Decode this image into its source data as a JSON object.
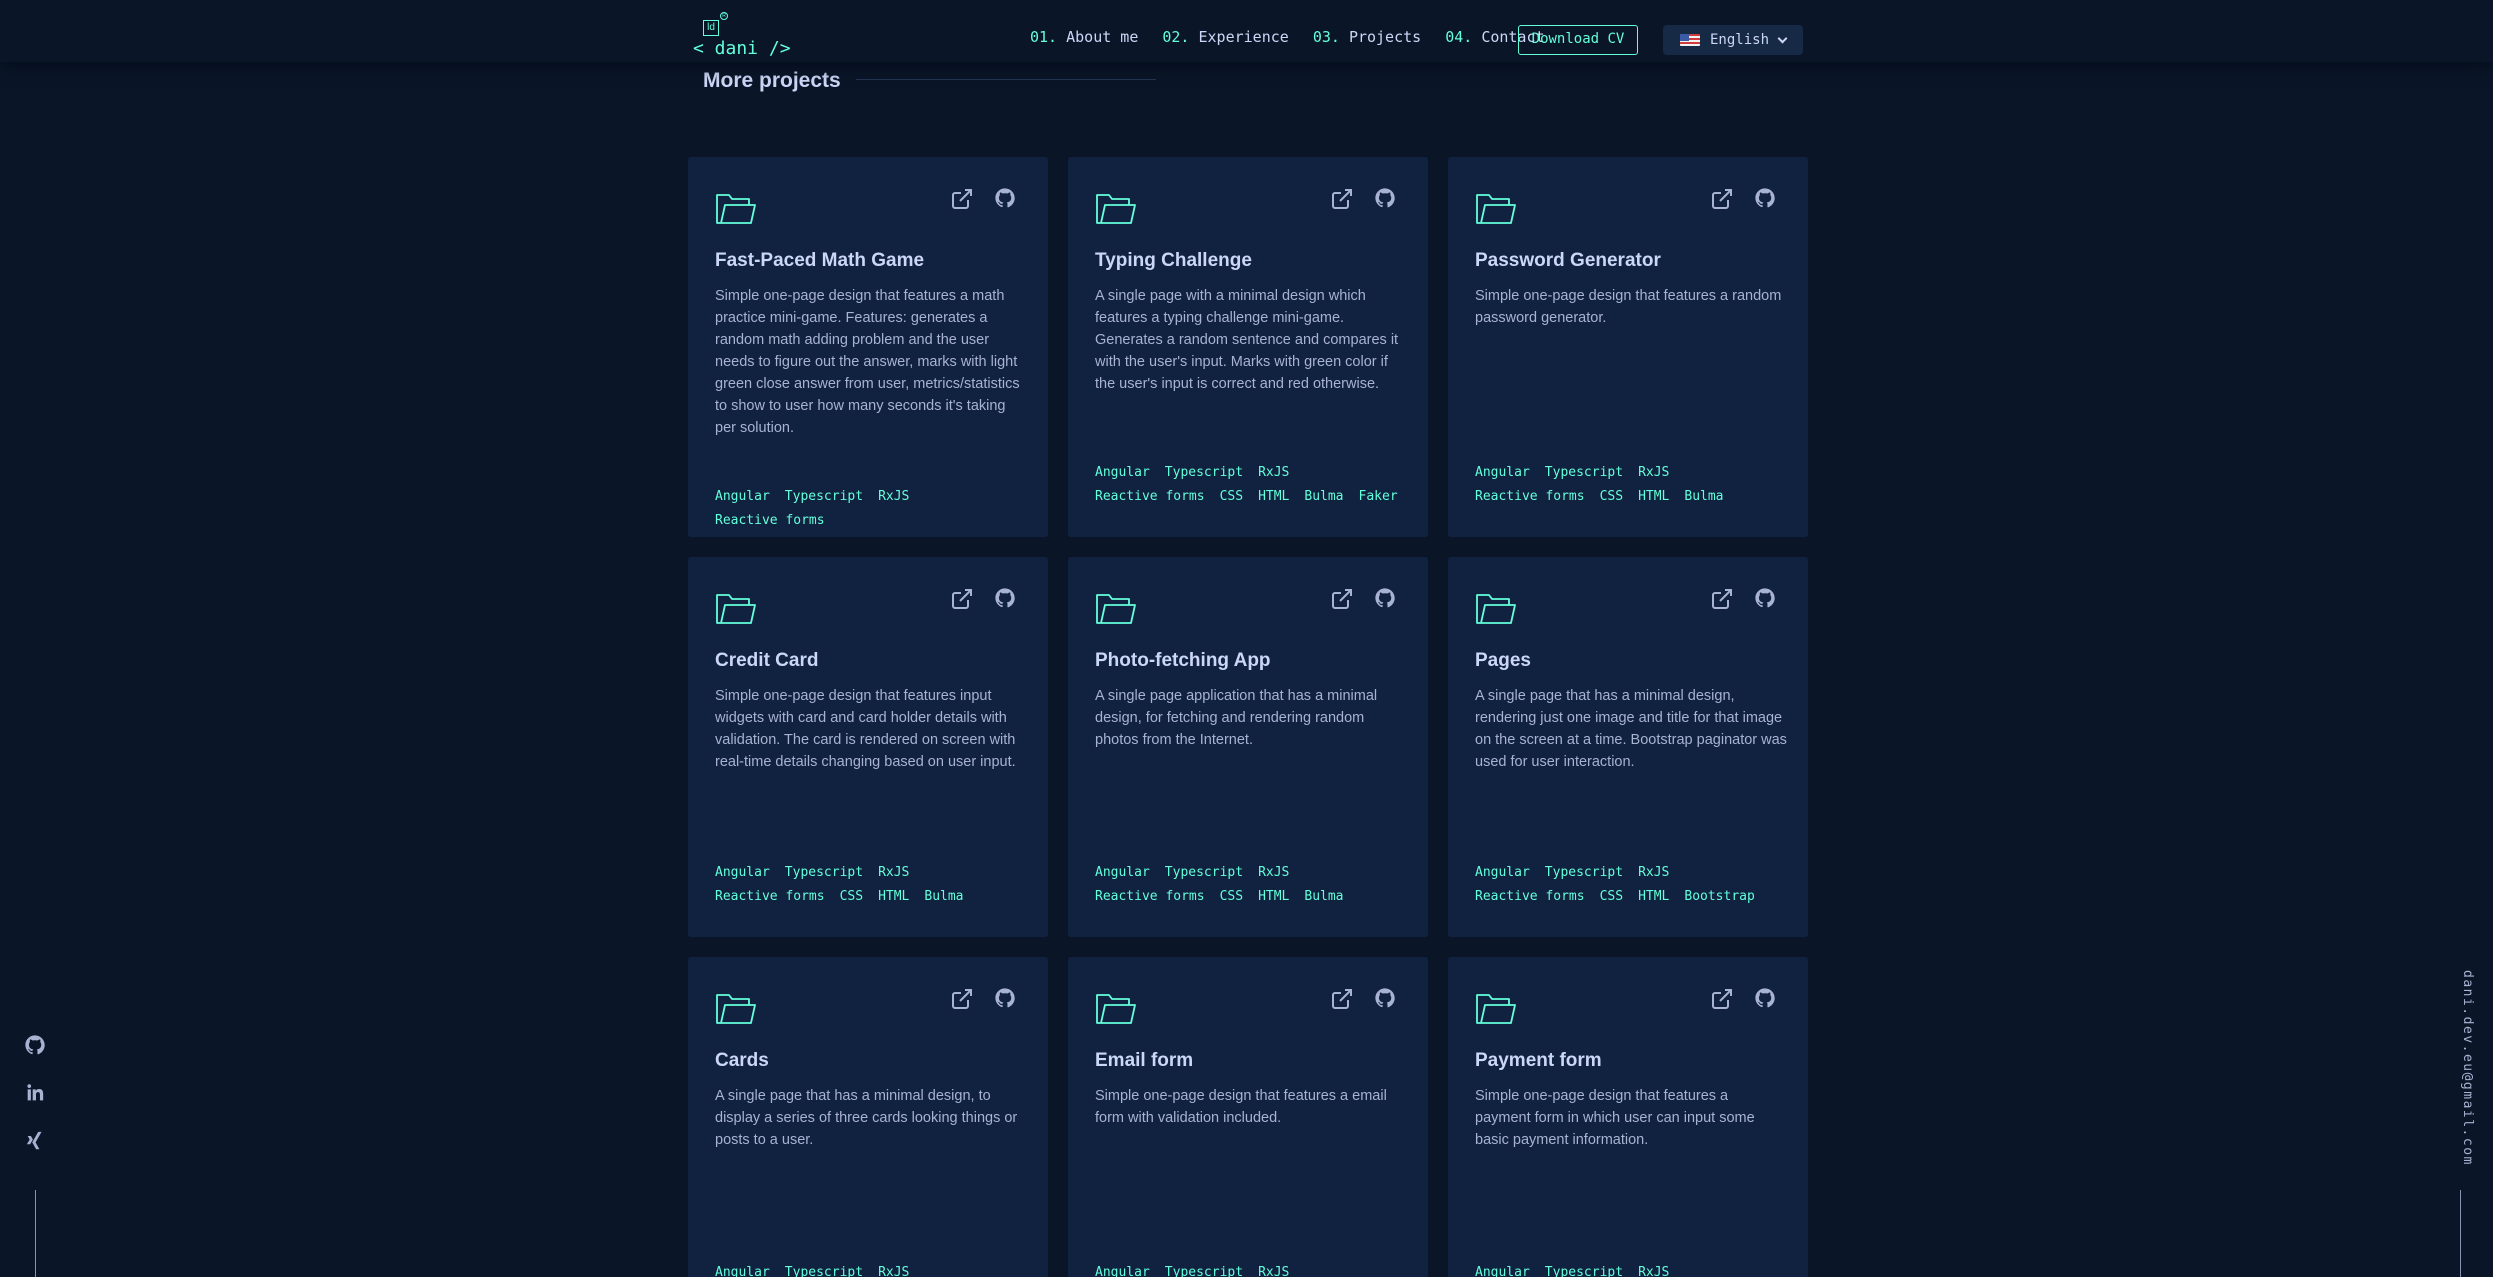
{
  "header": {
    "logo_text": "< dani />",
    "logo_mark": "ld",
    "logo_reg": "R",
    "nav": [
      {
        "num": "01.",
        "label": "About me"
      },
      {
        "num": "02.",
        "label": "Experience"
      },
      {
        "num": "03.",
        "label": "Projects"
      },
      {
        "num": "04.",
        "label": "Contact"
      }
    ],
    "download_cv": "Download CV",
    "language": {
      "label": "English",
      "flag_icon": "us-flag-icon"
    }
  },
  "section": {
    "title": "More projects"
  },
  "projects": [
    {
      "title": "Fast-Paced Math Game",
      "description": "Simple one-page design that features a math practice mini-game. Features: generates a random math adding problem and the user needs to figure out the answer, marks with light green close answer from user, metrics/statistics to show to user how many seconds it's taking per solution.",
      "tags": [
        "Angular",
        "Typescript",
        "RxJS",
        "Reactive forms"
      ]
    },
    {
      "title": "Typing Challenge",
      "description": "A single page with a minimal design which features a typing challenge mini-game. Generates a random sentence and compares it with the user's input. Marks with green color if the user's input is correct and red otherwise.",
      "tags": [
        "Angular",
        "Typescript",
        "RxJS",
        "Reactive forms",
        "CSS",
        "HTML",
        "Bulma",
        "Faker"
      ]
    },
    {
      "title": "Password Generator",
      "description": "Simple one-page design that features a random password generator.",
      "tags": [
        "Angular",
        "Typescript",
        "RxJS",
        "Reactive forms",
        "CSS",
        "HTML",
        "Bulma"
      ]
    },
    {
      "title": "Credit Card",
      "description": "Simple one-page design that features input widgets with card and card holder details with validation. The card is rendered on screen with real-time details changing based on user input.",
      "tags": [
        "Angular",
        "Typescript",
        "RxJS",
        "Reactive forms",
        "CSS",
        "HTML",
        "Bulma"
      ]
    },
    {
      "title": "Photo-fetching App",
      "description": "A single page application that has a minimal design, for fetching and rendering random photos from the Internet.",
      "tags": [
        "Angular",
        "Typescript",
        "RxJS",
        "Reactive forms",
        "CSS",
        "HTML",
        "Bulma"
      ]
    },
    {
      "title": "Pages",
      "description": "A single page that has a minimal design, rendering just one image and title for that image on the screen at a time. Bootstrap paginator was used for user interaction.",
      "tags": [
        "Angular",
        "Typescript",
        "RxJS",
        "Reactive forms",
        "CSS",
        "HTML",
        "Bootstrap"
      ]
    },
    {
      "title": "Cards",
      "description": "A single page that has a minimal design, to display a series of three cards looking things or posts to a user.",
      "tags": [
        "Angular",
        "Typescript",
        "RxJS"
      ]
    },
    {
      "title": "Email form",
      "description": "Simple one-page design that features a email form with validation included.",
      "tags": [
        "Angular",
        "Typescript",
        "RxJS"
      ]
    },
    {
      "title": "Payment form",
      "description": "Simple one-page design that features a payment form in which user can input some basic payment information.",
      "tags": [
        "Angular",
        "Typescript",
        "RxJS"
      ]
    }
  ],
  "sidebar": {
    "social": [
      "github-icon",
      "linkedin-icon",
      "xing-icon"
    ],
    "email": "dani.dev.eu@gmail.com"
  },
  "colors": {
    "background": "#0a1628",
    "card": "#112240",
    "accent": "#64ffda",
    "heading": "#ccd6f6",
    "text": "#a8b2d1"
  }
}
